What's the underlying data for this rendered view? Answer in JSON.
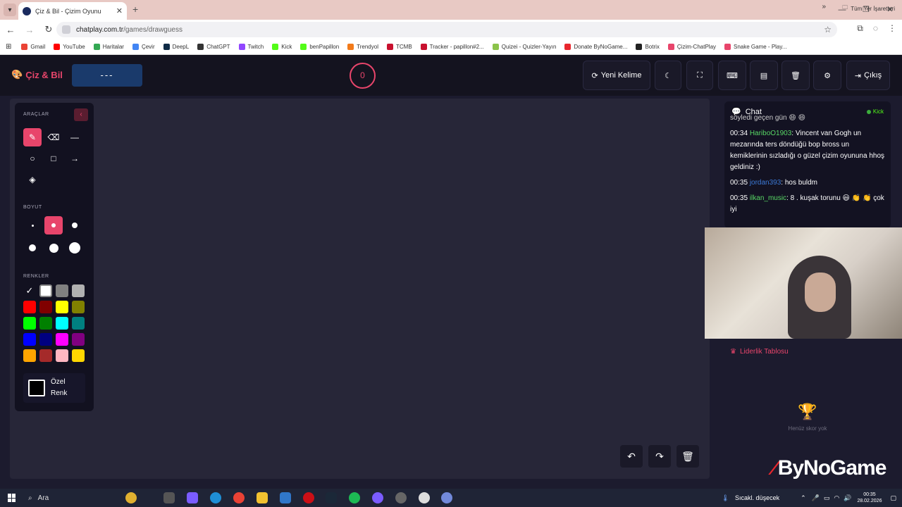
{
  "browser": {
    "tab_title": "Çiz & Bil - Çizim Oyunu",
    "url_host": "chatplay.com.tr",
    "url_path": "/games/drawguess",
    "bookmarks": [
      {
        "label": "Gmail",
        "color": "#ea4335"
      },
      {
        "label": "YouTube",
        "color": "#ff0000"
      },
      {
        "label": "Haritalar",
        "color": "#34a853"
      },
      {
        "label": "Çevir",
        "color": "#4285f4"
      },
      {
        "label": "DeepL",
        "color": "#0f2b46"
      },
      {
        "label": "ChatGPT",
        "color": "#333333"
      },
      {
        "label": "Twitch",
        "color": "#9146ff"
      },
      {
        "label": "Kick",
        "color": "#53fc18"
      },
      {
        "label": "benPapillon",
        "color": "#53fc18"
      },
      {
        "label": "Trendyol",
        "color": "#f27a1a"
      },
      {
        "label": "TCMB",
        "color": "#c8102e"
      },
      {
        "label": "Tracker - papillon#2...",
        "color": "#c8102e"
      },
      {
        "label": "Quizei - Quizler-Yayın",
        "color": "#8bc34a"
      },
      {
        "label": "Donate ByNoGame...",
        "color": "#e8262d"
      },
      {
        "label": "Botrix",
        "color": "#222222"
      },
      {
        "label": "Çizim-ChatPlay",
        "color": "#e8456b"
      },
      {
        "label": "Snake Game - Play...",
        "color": "#e8456b"
      }
    ],
    "all_bookmarks": "Tüm Yer İşaretleri"
  },
  "app": {
    "logo": "Çiz & Bil",
    "word_hint": "---",
    "score": "0",
    "buttons": {
      "new_word": "Yeni Kelime",
      "exit": "Çıkış"
    }
  },
  "tools": {
    "title": "ARAÇLAR",
    "size_title": "BOYUT",
    "colors_title": "RENKLER",
    "custom_color_line1": "Özel",
    "custom_color_line2": "Renk",
    "colors": [
      "#ffffff",
      "#ffffff",
      "#808080",
      "#b0b0b0",
      "#ff0000",
      "#800000",
      "#ffff00",
      "#808000",
      "#00ff00",
      "#008000",
      "#00ffff",
      "#008080",
      "#0000ff",
      "#000080",
      "#ff00ff",
      "#800080",
      "#ffa500",
      "#a52a2a",
      "#ffb6c1",
      "#ffd700"
    ]
  },
  "chat": {
    "title": "Chat",
    "platform": "Kick",
    "partial": "söyledi geçen gün 😄 😄",
    "messages": [
      {
        "time": "00:34",
        "user": "HariboO1903",
        "user_color": "#58d765",
        "text": ": Vincent van Gogh un mezarında ters döndüğü bop bross un kemiklerinin sızladığı o güzel çizim oyununa hhoş geldiniz :)"
      },
      {
        "time": "00:35",
        "user": "jordan393",
        "user_color": "#3b79d6",
        "text": ": hos buldm"
      },
      {
        "time": "00:35",
        "user": "ilkan_music",
        "user_color": "#58d765",
        "text": ": 8 . kuşak torunu 😃 👏 👏 çok iyi"
      }
    ]
  },
  "leaderboard": {
    "title": "Liderlik Tablosu",
    "empty": "Henüz skor yok"
  },
  "overlay": {
    "brand": "ByNoGame"
  },
  "taskbar": {
    "search": "Ara",
    "weather": "Sıcakl. düşecek",
    "time": "00:35",
    "date": "28.02.2026"
  }
}
